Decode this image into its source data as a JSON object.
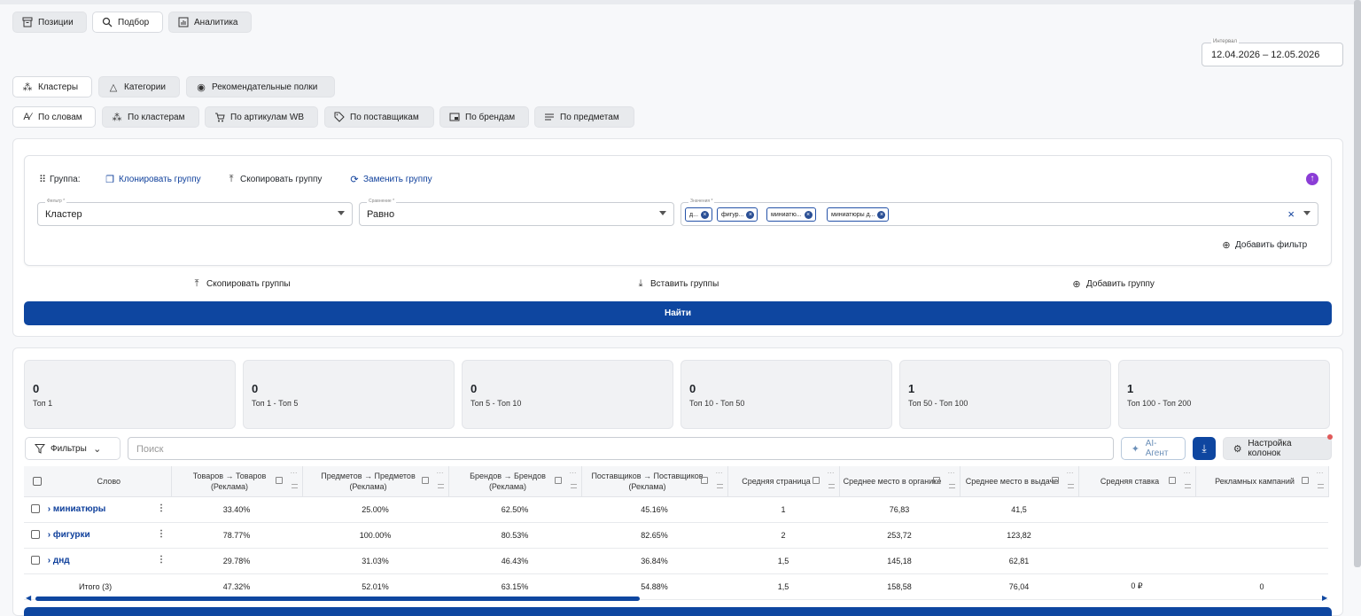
{
  "top_tabs": [
    {
      "label": "Позиции",
      "icon": "archive-icon"
    },
    {
      "label": "Подбор",
      "icon": "search-icon"
    },
    {
      "label": "Аналитика",
      "icon": "chart-icon"
    }
  ],
  "date_range": {
    "label": "Интервал",
    "value": "12.04.2026 – 12.05.2026"
  },
  "mode_tabs": [
    {
      "label": "Кластеры",
      "icon": "clusters-icon"
    },
    {
      "label": "Категории",
      "icon": "categories-icon"
    },
    {
      "label": "Рекомендательные полки",
      "icon": "shelves-icon"
    }
  ],
  "view_tabs": [
    {
      "label": "По словам",
      "icon": "words-icon"
    },
    {
      "label": "По кластерам",
      "icon": "clusters-icon"
    },
    {
      "label": "По артикулам WB",
      "icon": "cart-icon"
    },
    {
      "label": "По поставщикам",
      "icon": "tag-icon"
    },
    {
      "label": "По брендам",
      "icon": "brand-icon"
    },
    {
      "label": "По предметам",
      "icon": "list-icon"
    }
  ],
  "group": {
    "label": "Группа:",
    "clone": "Клонировать группу",
    "copy": "Скопировать группу",
    "replace": "Заменить группу",
    "filter_label": "Фильтр *",
    "filter_value": "Кластер",
    "compare_label": "Сравнение *",
    "compare_value": "Равно",
    "values_label": "Значения *",
    "chips": [
      "д...",
      "фигур...",
      "миниатю...",
      "миниатюры д..."
    ],
    "add_filter": "Добавить фильтр"
  },
  "group_actions": {
    "copy_groups": "Скопировать группы",
    "paste_groups": "Вставить группы",
    "add_group": "Добавить группу"
  },
  "find_button": "Найти",
  "stats": [
    {
      "value": "0",
      "label": "Топ 1"
    },
    {
      "value": "0",
      "label": "Топ 1 - Топ 5"
    },
    {
      "value": "0",
      "label": "Топ 5 - Топ 10"
    },
    {
      "value": "0",
      "label": "Топ 10 - Топ 50"
    },
    {
      "value": "1",
      "label": "Топ 50 - Топ 100"
    },
    {
      "value": "1",
      "label": "Топ 100 - Топ 200"
    }
  ],
  "toolbar": {
    "filters": "Фильтры",
    "search_placeholder": "Поиск",
    "ai_agent": "AI-Агент",
    "columns_settings": "Настройка колонок"
  },
  "table": {
    "headers": [
      "Слово",
      "Товаров → Товаров (Реклама)",
      "Предметов → Предметов (Реклама)",
      "Брендов → Брендов (Реклама)",
      "Поставщиков → Поставщиков (Реклама)",
      "Средняя страница",
      "Среднее место в органике",
      "Среднее место в выдаче",
      "Средняя ставка",
      "Рекламных кампаний"
    ],
    "rows": [
      {
        "word": "миниатюры",
        "c1": "33.40%",
        "c2": "25.00%",
        "c3": "62.50%",
        "c4": "45.16%",
        "c5": "1",
        "c6": "76,83",
        "c7": "41,5",
        "c8": "",
        "c9": ""
      },
      {
        "word": "фигурки",
        "c1": "78.77%",
        "c2": "100.00%",
        "c3": "80.53%",
        "c4": "82.65%",
        "c5": "2",
        "c6": "253,72",
        "c7": "123,82",
        "c8": "",
        "c9": ""
      },
      {
        "word": "днд",
        "c1": "29.78%",
        "c2": "31.03%",
        "c3": "46.43%",
        "c4": "36.84%",
        "c5": "1,5",
        "c6": "145,18",
        "c7": "62,81",
        "c8": "",
        "c9": ""
      }
    ],
    "total": {
      "word": "Итого (3)",
      "c1": "47.32%",
      "c2": "52.01%",
      "c3": "63.15%",
      "c4": "54.88%",
      "c5": "1,5",
      "c6": "158,58",
      "c7": "76,04",
      "c8": "0 ₽",
      "c9": "0"
    }
  },
  "colors": {
    "primary": "#0e46a0",
    "link": "#0e3f9b",
    "accent_purple": "#8b3dd6",
    "dot_red": "#e05a5a"
  }
}
